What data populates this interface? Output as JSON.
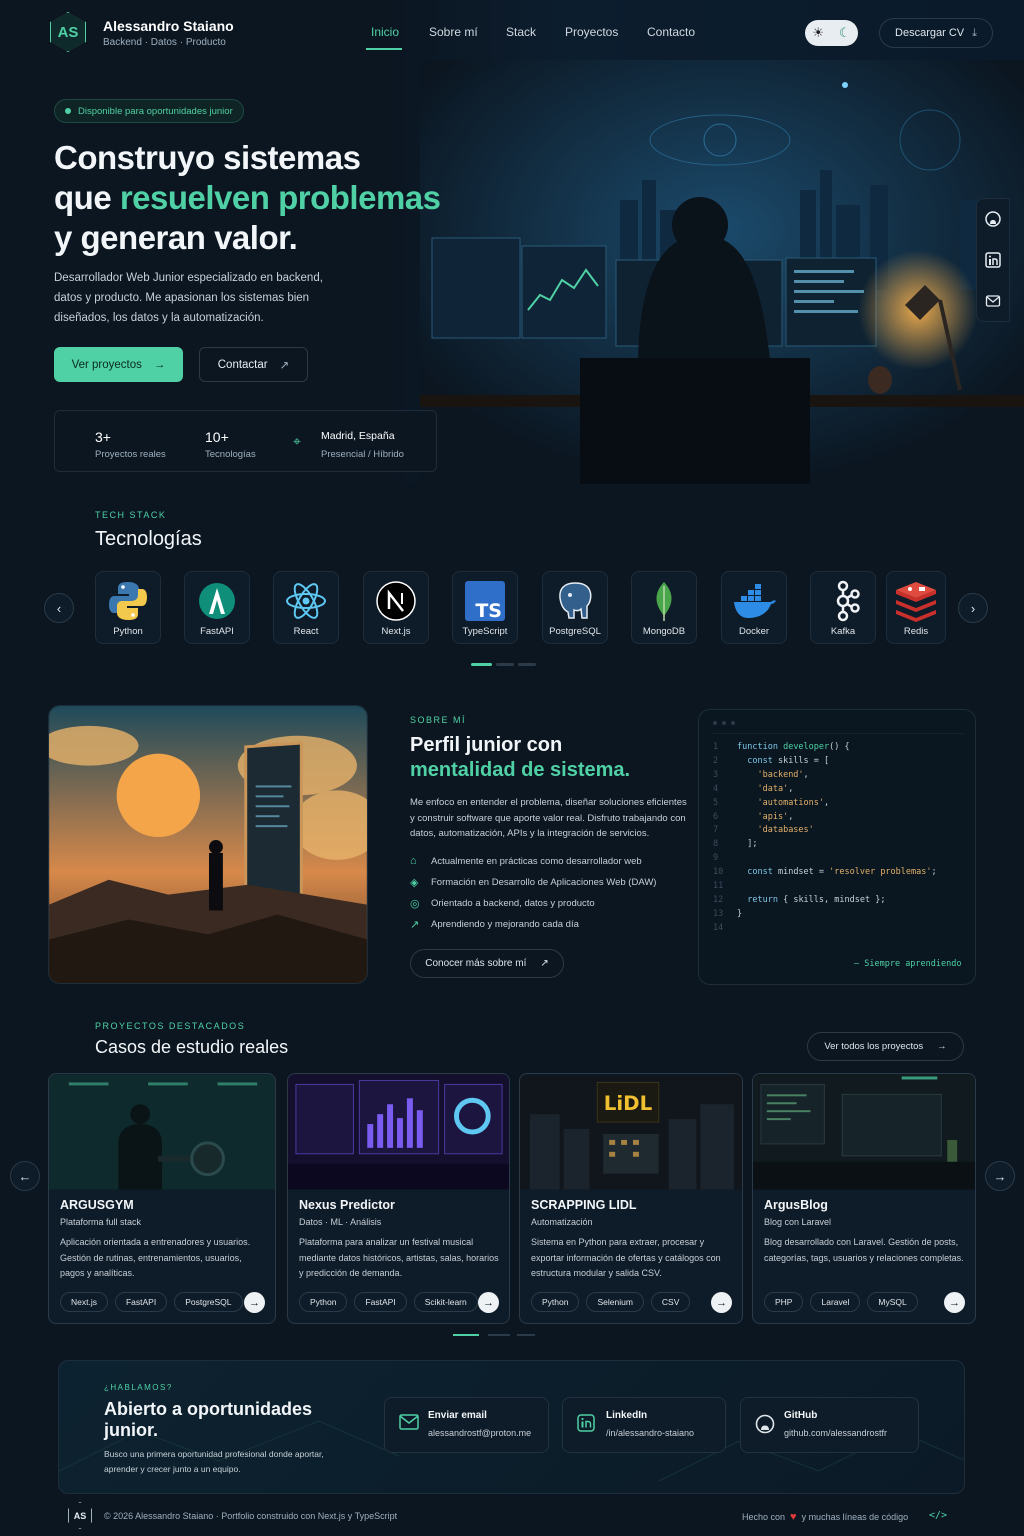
{
  "brand": {
    "initials": "AS",
    "name": "Alessandro Staiano",
    "tagline": "Backend · Datos · Producto"
  },
  "nav": {
    "items": [
      "Inicio",
      "Sobre mí",
      "Stack",
      "Proyectos",
      "Contacto"
    ],
    "active": "Inicio"
  },
  "header": {
    "cv_label": "Descargar CV"
  },
  "hero": {
    "badge": "Disponible para oportunidades junior",
    "title_1": "Construyo sistemas",
    "title_2a": "que ",
    "title_2b": "resuelven problemas",
    "title_3": "y generan valor.",
    "description": "Desarrollador Web Junior especializado en backend, datos y producto. Me apasionan los sistemas bien diseñados, los datos y la automatización.",
    "primary_cta": "Ver proyectos",
    "secondary_cta": "Contactar",
    "stats": [
      {
        "value": "3+",
        "label": "Proyectos reales"
      },
      {
        "value": "10+",
        "label": "Tecnologías"
      },
      {
        "value": "Madrid, España",
        "label": "Presencial / Híbrido"
      }
    ]
  },
  "tech": {
    "label": "TECH STACK",
    "title": "Tecnologías",
    "items": [
      "Python",
      "FastAPI",
      "React",
      "Next.js",
      "TypeScript",
      "PostgreSQL",
      "MongoDB",
      "Docker",
      "Kafka",
      "Redis"
    ]
  },
  "about": {
    "label": "SOBRE MÍ",
    "title_1": "Perfil junior con",
    "title_2": "mentalidad de sistema.",
    "paragraph": "Me enfoco en entender el problema, diseñar soluciones eficientes y construir software que aporte valor real. Disfruto trabajando con datos, automatización, APIs y la integración de servicios.",
    "points": [
      "Actualmente en prácticas como desarrollador web",
      "Formación en Desarrollo de Aplicaciones Web (DAW)",
      "Orientado a backend, datos y producto",
      "Aprendiendo y mejorando cada día"
    ],
    "cta": "Conocer más sobre mí",
    "code_footer": "Siempre aprendiendo",
    "code_lines": [
      {
        "n": "1",
        "code": "function developer() {"
      },
      {
        "n": "2",
        "code": "  const skills = ["
      },
      {
        "n": "3",
        "code": "    'backend',"
      },
      {
        "n": "4",
        "code": "    'data',"
      },
      {
        "n": "5",
        "code": "    'automations',"
      },
      {
        "n": "6",
        "code": "    'apis',"
      },
      {
        "n": "7",
        "code": "    'databases'"
      },
      {
        "n": "8",
        "code": "  ];"
      },
      {
        "n": "9",
        "code": ""
      },
      {
        "n": "10",
        "code": "  const mindset = 'resolver problemas';"
      },
      {
        "n": "11",
        "code": ""
      },
      {
        "n": "12",
        "code": "  return { skills, mindset };"
      },
      {
        "n": "13",
        "code": "}"
      },
      {
        "n": "14",
        "code": ""
      }
    ]
  },
  "projects": {
    "label": "PROYECTOS DESTACADOS",
    "title": "Casos de estudio reales",
    "all_label": "Ver todos los proyectos",
    "items": [
      {
        "title": "ARGUSGYM",
        "subtitle": "Plataforma full stack",
        "description": "Aplicación orientada a entrenadores y usuarios. Gestión de rutinas, entrenamientos, usuarios, pagos y analíticas.",
        "tags": [
          "Next.js",
          "FastAPI",
          "PostgreSQL"
        ]
      },
      {
        "title": "Nexus Predictor",
        "subtitle": "Datos · ML · Análisis",
        "description": "Plataforma para analizar un festival musical mediante datos históricos, artistas, salas, horarios y predicción de demanda.",
        "tags": [
          "Python",
          "FastAPI",
          "Scikit-learn"
        ]
      },
      {
        "title": "SCRAPPING LIDL",
        "subtitle": "Automatización",
        "description": "Sistema en Python para extraer, procesar y exportar información de ofertas y catálogos con estructura modular y salida CSV.",
        "tags": [
          "Python",
          "Selenium",
          "CSV"
        ]
      },
      {
        "title": "ArgusBlog",
        "subtitle": "Blog con Laravel",
        "description": "Blog desarrollado con Laravel. Gestión de posts, categorías, tags, usuarios y relaciones completas.",
        "tags": [
          "PHP",
          "Laravel",
          "MySQL"
        ]
      }
    ],
    "lidl_sign": "LiDL"
  },
  "contact": {
    "label": "¿HABLAMOS?",
    "title": "Abierto a oportunidades junior.",
    "description": "Busco una primera oportunidad profesional donde aportar, aprender y crecer junto a un equipo.",
    "cards": [
      {
        "title": "Enviar email",
        "value": "alessandrostf@proton.me"
      },
      {
        "title": "LinkedIn",
        "value": "/in/alessandro-staiano"
      },
      {
        "title": "GitHub",
        "value": "github.com/alessandrostfr"
      }
    ]
  },
  "footer": {
    "copyright": "© 2026 Alessandro Staiano · Portfolio construido con Next.js y TypeScript",
    "made_with_1": "Hecho con",
    "made_with_2": "y muchas líneas de código",
    "code_icon": "</>"
  },
  "colors": {
    "accent": "#4fd1a5",
    "background": "#0b1621",
    "card": "#0e1b28"
  }
}
